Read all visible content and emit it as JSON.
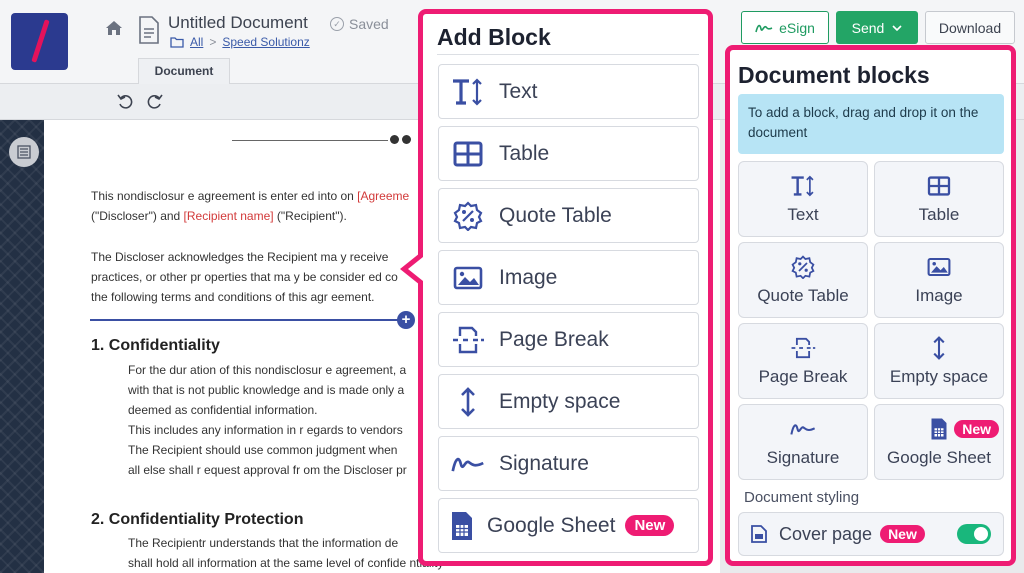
{
  "header": {
    "doc_title": "Untitled Document",
    "saved_label": "Saved",
    "breadcrumb_all": "All",
    "breadcrumb_sep": ">",
    "breadcrumb_folder": "Speed Solutionz",
    "tab_document": "Document",
    "esign_label": "eSign",
    "send_label": "Send",
    "download_label": "Download"
  },
  "document": {
    "para1_line1_a": "This nondisclosur e agreement is enter ed into on ",
    "para1_line1_ph": "[Agreeme",
    "para1_line2_a": "(\"Discloser\") and ",
    "para1_line2_ph": "[Recipient name]",
    "para1_line2_b": " (\"Recipient\").",
    "para2_line1": "The Discloser acknowledges the Recipient ma  y receive",
    "para2_line2": "practices, or other pr operties that ma y be consider ed co",
    "para2_line3": "the following terms and conditions of this agr   eement.",
    "heading1": "1. Confidentiality",
    "s1_line1": "For the dur ation of this nondisclosur  e agreement, a",
    "s1_line2": "with that is not public knowledge and is made only a",
    "s1_line3": "deemed as confidential information.",
    "s1_line4": "This includes any information in r   egards to vendors",
    "s1_line5": "The Recipient should use common judgment when",
    "s1_line6": "all else shall r equest approval fr om the Discloser pr",
    "heading2": "2. Confidentiality Protection",
    "s2_line1": "The Recipientr understands that the information de",
    "s2_line2": "shall hold all information at the same level of confide ntiality"
  },
  "add_block": {
    "title": "Add Block",
    "items": [
      {
        "label": "Text",
        "icon": "text-icon"
      },
      {
        "label": "Table",
        "icon": "table-icon"
      },
      {
        "label": "Quote Table",
        "icon": "quote-table-icon"
      },
      {
        "label": "Image",
        "icon": "image-icon"
      },
      {
        "label": "Page Break",
        "icon": "page-break-icon"
      },
      {
        "label": "Empty space",
        "icon": "empty-space-icon"
      },
      {
        "label": "Signature",
        "icon": "signature-icon"
      },
      {
        "label": "Google Sheet",
        "icon": "google-sheet-icon",
        "badge": "New"
      }
    ]
  },
  "document_blocks": {
    "title": "Document blocks",
    "info": "To add a block, drag and drop it on the document",
    "tiles": [
      {
        "label": "Text",
        "icon": "text-icon"
      },
      {
        "label": "Table",
        "icon": "table-icon"
      },
      {
        "label": "Quote Table",
        "icon": "quote-table-icon"
      },
      {
        "label": "Image",
        "icon": "image-icon"
      },
      {
        "label": "Page Break",
        "icon": "page-break-icon"
      },
      {
        "label": "Empty space",
        "icon": "empty-space-icon"
      },
      {
        "label": "Signature",
        "icon": "signature-icon"
      },
      {
        "label": "Google Sheet",
        "icon": "google-sheet-icon",
        "badge": "New"
      }
    ],
    "styling_label": "Document styling",
    "cover_page_label": "Cover page",
    "cover_page_badge": "New",
    "cover_page_enabled": true
  },
  "colors": {
    "accent_pink": "#ee1c73",
    "brand_blue": "#2b3a8f",
    "icon_blue": "#3a4fa3",
    "send_green": "#23a566",
    "toggle_green": "#19b77c",
    "placeholder_red": "#d23a3a"
  }
}
